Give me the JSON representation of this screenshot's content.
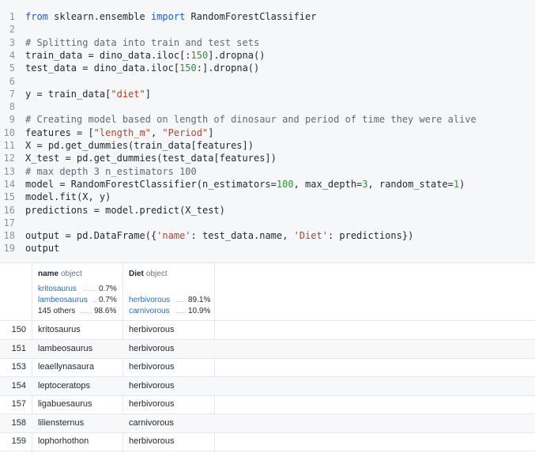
{
  "code": {
    "lines": [
      {
        "n": "1",
        "parts": [
          {
            "t": "from",
            "c": "kw"
          },
          {
            "t": " sklearn.ensemble "
          },
          {
            "t": "import",
            "c": "kw"
          },
          {
            "t": " RandomForestClassifier"
          }
        ]
      },
      {
        "n": "2",
        "parts": []
      },
      {
        "n": "3",
        "parts": [
          {
            "t": "# Splitting data into train and test sets",
            "c": "cmt"
          }
        ]
      },
      {
        "n": "4",
        "parts": [
          {
            "t": "train_data = dino_data.iloc[:"
          },
          {
            "t": "150",
            "c": "num"
          },
          {
            "t": "].dropna()"
          }
        ]
      },
      {
        "n": "5",
        "parts": [
          {
            "t": "test_data = dino_data.iloc["
          },
          {
            "t": "150",
            "c": "num"
          },
          {
            "t": ":].dropna()"
          }
        ]
      },
      {
        "n": "6",
        "parts": []
      },
      {
        "n": "7",
        "parts": [
          {
            "t": "y = train_data["
          },
          {
            "t": "\"diet\"",
            "c": "str"
          },
          {
            "t": "]"
          }
        ]
      },
      {
        "n": "8",
        "parts": []
      },
      {
        "n": "9",
        "parts": [
          {
            "t": "# Creating model based on length of dinosaur and period of time they were alive",
            "c": "cmt"
          }
        ]
      },
      {
        "n": "10",
        "parts": [
          {
            "t": "features = ["
          },
          {
            "t": "\"length_m\"",
            "c": "str"
          },
          {
            "t": ", "
          },
          {
            "t": "\"Period\"",
            "c": "str"
          },
          {
            "t": "]"
          }
        ]
      },
      {
        "n": "11",
        "parts": [
          {
            "t": "X = pd.get_dummies(train_data[features])"
          }
        ]
      },
      {
        "n": "12",
        "parts": [
          {
            "t": "X_test = pd.get_dummies(test_data[features])"
          }
        ]
      },
      {
        "n": "13",
        "parts": [
          {
            "t": "# max depth 3 n_estimators 100",
            "c": "cmt"
          }
        ]
      },
      {
        "n": "14",
        "parts": [
          {
            "t": "model = RandomForestClassifier(n_estimators="
          },
          {
            "t": "100",
            "c": "num"
          },
          {
            "t": ", max_depth="
          },
          {
            "t": "3",
            "c": "num"
          },
          {
            "t": ", random_state="
          },
          {
            "t": "1",
            "c": "num"
          },
          {
            "t": ")"
          }
        ]
      },
      {
        "n": "15",
        "parts": [
          {
            "t": "model.fit(X, y)"
          }
        ]
      },
      {
        "n": "16",
        "parts": [
          {
            "t": "predictions = model.predict(X_test)"
          }
        ]
      },
      {
        "n": "17",
        "parts": []
      },
      {
        "n": "18",
        "parts": [
          {
            "t": "output = pd.DataFrame({"
          },
          {
            "t": "'name'",
            "c": "str"
          },
          {
            "t": ": test_data.name, "
          },
          {
            "t": "'Diet'",
            "c": "str"
          },
          {
            "t": ": predictions})"
          }
        ]
      },
      {
        "n": "19",
        "parts": [
          {
            "t": "output"
          }
        ]
      }
    ]
  },
  "table": {
    "columns": [
      {
        "name": "name",
        "dtype": "object",
        "stats": [
          {
            "label": "kritosaurus",
            "pct": "0.7%",
            "link": true
          },
          {
            "label": "lambeosaurus",
            "pct": "0.7%",
            "link": true
          },
          {
            "label": "145 others",
            "pct": "98.6%",
            "link": false
          }
        ]
      },
      {
        "name": "Diet",
        "dtype": "object",
        "stats": [
          {
            "label": "herbivorous",
            "pct": "89.1%",
            "link": true
          },
          {
            "label": "carnivorous",
            "pct": "10.9%",
            "link": true
          }
        ]
      }
    ],
    "rows": [
      {
        "idx": "150",
        "name": "kritosaurus",
        "diet": "herbivorous"
      },
      {
        "idx": "151",
        "name": "lambeosaurus",
        "diet": "herbivorous"
      },
      {
        "idx": "153",
        "name": "leaellynasaura",
        "diet": "herbivorous"
      },
      {
        "idx": "154",
        "name": "leptoceratops",
        "diet": "herbivorous"
      },
      {
        "idx": "157",
        "name": "ligabuesaurus",
        "diet": "herbivorous"
      },
      {
        "idx": "158",
        "name": "liliensternus",
        "diet": "carnivorous"
      },
      {
        "idx": "159",
        "name": "lophorhothon",
        "diet": "herbivorous"
      }
    ]
  }
}
